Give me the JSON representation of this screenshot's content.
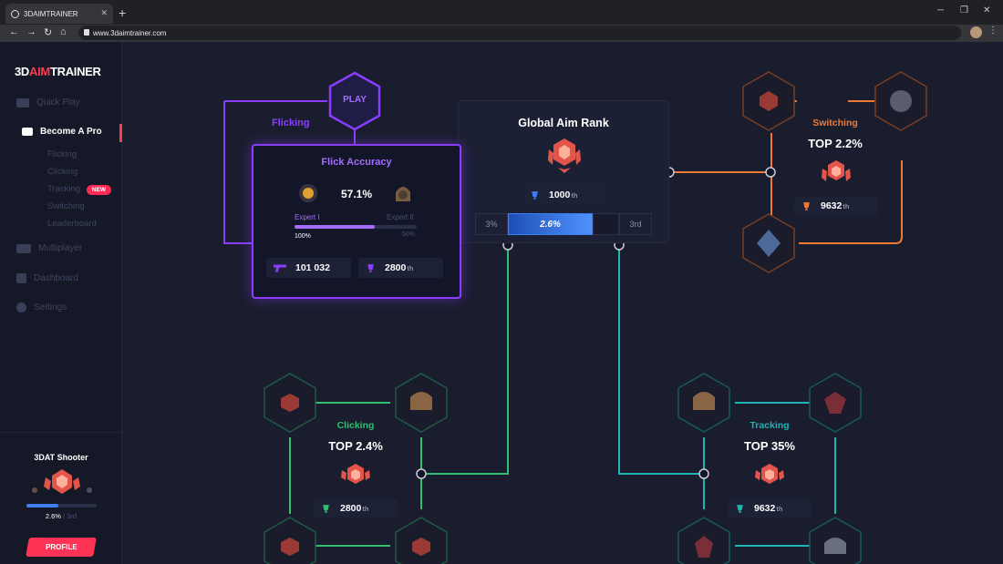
{
  "browser": {
    "tab_title": "3DAIMTRAINER",
    "url": "www.3daimtrainer.com",
    "new_tab": "+",
    "tab_close": "✕",
    "minimize": "─",
    "restore": "❐",
    "close": "✕",
    "back": "←",
    "forward": "→",
    "reload": "↻",
    "home": "⌂",
    "menu": "⋮"
  },
  "logo": {
    "part1": "3D",
    "part2": "AIM",
    "part3": "TRAINER"
  },
  "sidebar": {
    "items": [
      {
        "label": "Quick Play",
        "icon": "pistol-icon"
      },
      {
        "label": "Become A Pro",
        "icon": "graduation-cap-icon"
      },
      {
        "label": "Multiplayer",
        "icon": "rifle-icon"
      },
      {
        "label": "Dashboard",
        "icon": "dashboard-icon"
      },
      {
        "label": "Settings",
        "icon": "gear-icon"
      }
    ],
    "subitems": [
      "Flicking",
      "Clicking",
      "Tracking",
      "Switching",
      "Leaderboard"
    ],
    "new_badge": "NEW",
    "player": {
      "name": "3DAT Shooter",
      "percent": "2.6%",
      "separator": "/",
      "rank": "3rd",
      "progress": 0.45,
      "button": "PROFILE"
    }
  },
  "play_button": "PLAY",
  "flicking": {
    "label": "Flicking",
    "card_title": "Flick Accuracy",
    "accuracy": "57.1%",
    "level_left": "Expert I",
    "level_right": "Expert II",
    "pct_left": "100%",
    "pct_right": "50%",
    "progress": 0.66,
    "shots": "101 032",
    "rank": "2800",
    "rank_suffix": "th"
  },
  "global": {
    "title": "Global Aim Rank",
    "rank": "1000",
    "rank_suffix": "th",
    "left": "3%",
    "current": "2.6%",
    "right": "3rd"
  },
  "switching": {
    "label": "Switching",
    "top": "TOP 2.2%",
    "rank": "9632",
    "rank_suffix": "th"
  },
  "clicking": {
    "label": "Clicking",
    "top": "TOP 2.4%",
    "rank": "2800",
    "rank_suffix": "th"
  },
  "tracking": {
    "label": "Tracking",
    "top": "TOP 35%",
    "rank": "9632",
    "rank_suffix": "th"
  },
  "colors": {
    "accent_red": "#ff3a4f",
    "purple": "#8b3dff",
    "orange": "#f07a35",
    "green": "#2fbf6f",
    "teal": "#1fb5b5",
    "blue": "#3b7ff5"
  }
}
